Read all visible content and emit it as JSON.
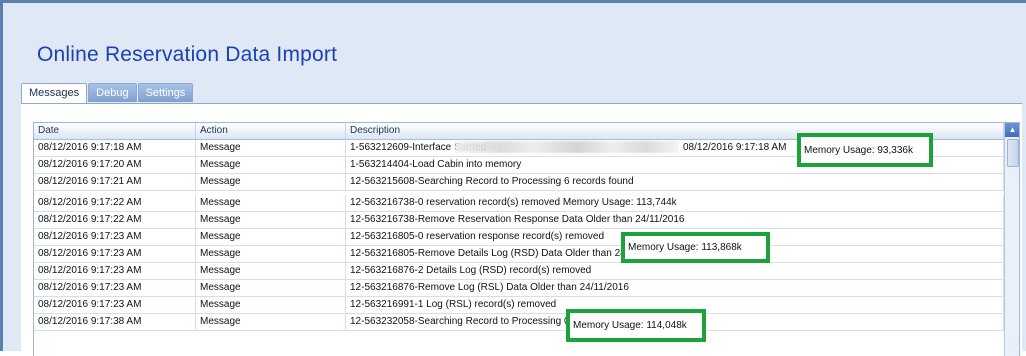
{
  "app": {
    "title": "Online Reservation Data Import"
  },
  "tabs": [
    {
      "label": "Messages",
      "active": true
    },
    {
      "label": "Debug",
      "active": false
    },
    {
      "label": "Settings",
      "active": false
    }
  ],
  "grid": {
    "columns": [
      "Date",
      "Action",
      "Description"
    ],
    "rows": [
      {
        "date": "08/12/2016 9:17:18 AM",
        "action": "Message",
        "description": "1-563212609-Interface Started -"
      },
      {
        "date": "08/12/2016 9:17:20 AM",
        "action": "Message",
        "description": "1-563214404-Load Cabin into memory"
      },
      {
        "date": "08/12/2016 9:17:21 AM",
        "action": "Message",
        "description": "12-563215608-Searching Record to Processing 6 records found"
      },
      {
        "date": "08/12/2016 9:17:22 AM",
        "action": "Message",
        "description": "12-563216738-0 reservation record(s) removed Memory Usage: 113,744k"
      },
      {
        "date": "08/12/2016 9:17:22 AM",
        "action": "Message",
        "description": "12-563216738-Remove Reservation Response Data Older than 24/11/2016"
      },
      {
        "date": "08/12/2016 9:17:23 AM",
        "action": "Message",
        "description": "12-563216805-0 reservation response record(s) removed"
      },
      {
        "date": "08/12/2016 9:17:23 AM",
        "action": "Message",
        "description": "12-563216805-Remove Details Log (RSD) Data Older than 24/11/2016"
      },
      {
        "date": "08/12/2016 9:17:23 AM",
        "action": "Message",
        "description": "12-563216876-2 Details Log (RSD) record(s) removed"
      },
      {
        "date": "08/12/2016 9:17:23 AM",
        "action": "Message",
        "description": "12-563216876-Remove Log (RSL) Data Older than 24/11/2016"
      },
      {
        "date": "08/12/2016 9:17:23 AM",
        "action": "Message",
        "description": "12-563216991-1 Log (RSL) record(s) removed"
      },
      {
        "date": "08/12/2016 9:17:38 AM",
        "action": "Message",
        "description": "12-563232058-Searching Record to Processing 0 record found"
      }
    ],
    "row0_suffix": "08/12/2016 9:17:18 AM"
  },
  "highlights": {
    "mem1": "Memory Usage: 93,336k",
    "mem2": "Memory Usage: 113,868k",
    "mem3": "Memory Usage: 114,048k",
    "color": "#1da23b"
  }
}
